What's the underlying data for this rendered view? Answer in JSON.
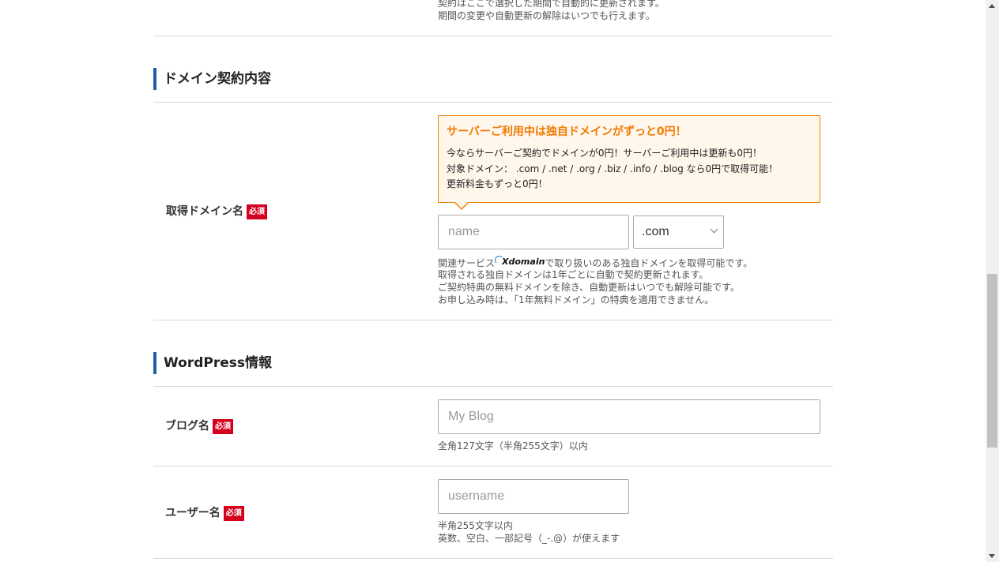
{
  "top_notes": {
    "line1": "契約はここで選択した期間で自動的に更新されます。",
    "line2": "期間の変更や自動更新の解除はいつでも行えます。"
  },
  "domain_section": {
    "title": "ドメイン契約内容",
    "label": "取得ドメイン名",
    "required_badge": "必須",
    "promo": {
      "title": "サーバーご利用中は独自ドメインがずっと0円！",
      "line1": "今ならサーバーご契約でドメインが0円！サーバーご利用中は更新も0円！",
      "line2": "対象ドメイン： .com / .net / .org / .biz / .info / .blog なら0円で取得可能！",
      "line3": "更新料金もずっと0円！"
    },
    "name_input": {
      "placeholder": "name",
      "value": ""
    },
    "tld_select": {
      "value": ".com"
    },
    "notes": {
      "line1_before": "関連サービス",
      "logo": "Xdomain",
      "line1_after": "で取り扱いのある独自ドメインを取得可能です。",
      "line2": "取得される独自ドメインは1年ごとに自動で契約更新されます。",
      "line3": "ご契約特典の無料ドメインを除き、自動更新はいつでも解除可能です。",
      "line4": "お申し込み時は、「1年無料ドメイン」の特典を適用できません。"
    }
  },
  "wordpress_section": {
    "title": "WordPress情報",
    "blog_name": {
      "label": "ブログ名",
      "required_badge": "必須",
      "placeholder": "My Blog",
      "note": "全角127文字（半角255文字）以内"
    },
    "username": {
      "label": "ユーザー名",
      "required_badge": "必須",
      "placeholder": "username",
      "note1": "半角255文字以内",
      "note2": "英数、空白、一部記号（_-.@）が使えます"
    }
  },
  "colors": {
    "accent_bar": "#1f5fa8",
    "required_badge": "#d3001e",
    "promo_border": "#f08300",
    "promo_bg": "#fff6ec"
  }
}
